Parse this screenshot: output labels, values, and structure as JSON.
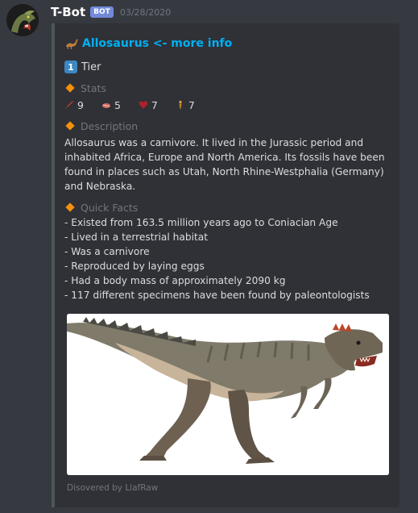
{
  "message": {
    "username": "T-Bot",
    "bot_tag": "BOT",
    "timestamp": "03/28/2020"
  },
  "embed": {
    "title": "Allosaurus <- more info",
    "title_icon": "sauropod-icon",
    "tier": {
      "number": "1",
      "label": "Tier"
    },
    "stats_label": "Stats",
    "stats": [
      {
        "icon": "dagger-icon",
        "value": "9"
      },
      {
        "icon": "meat-icon",
        "value": "5"
      },
      {
        "icon": "heart-icon",
        "value": "7"
      },
      {
        "icon": "figure-icon",
        "value": "7"
      }
    ],
    "description_label": "Description",
    "description": "Allosaurus was a carnivore. It lived in the Jurassic period and inhabited Africa, Europe and North America. Its fossils have been found in places such as Utah, North Rhine-Westphalia (Germany) and Nebraska.",
    "quick_facts_label": "Quick Facts",
    "quick_facts": [
      "- Existed from 163.5 million years ago to Coniacian Age",
      "- Lived in a terrestrial habitat",
      "- Was a carnivore",
      "- Reproduced by laying eggs",
      "- Had a body mass of approximately 2090 kg",
      "- 117 different specimens have been found by paleontologists"
    ],
    "footer": "Disovered by LlafRaw"
  },
  "colors": {
    "background": "#36393f",
    "embed_bg": "#2f3136",
    "link": "#00b0f4",
    "bot_tag": "#7289da",
    "diamond": "#f4900c",
    "muted": "#72767d"
  }
}
